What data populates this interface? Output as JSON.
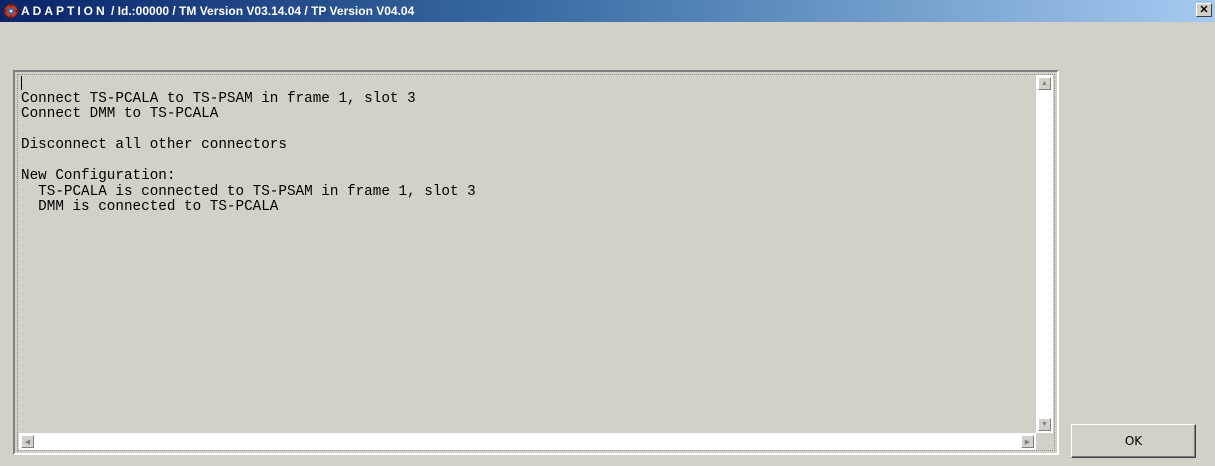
{
  "window": {
    "title_app": "ADAPTION",
    "title_rest": " / Id.:00000 / TM Version V03.14.04 / TP Version V04.04",
    "close_glyph": "✕",
    "icon": "app-gear-icon"
  },
  "content": {
    "lines": [
      "",
      "Connect TS-PCALA to TS-PSAM in frame 1, slot 3",
      "Connect DMM to TS-PCALA",
      "",
      "Disconnect all other connectors",
      "",
      "New Configuration:",
      "  TS-PCALA is connected to TS-PSAM in frame 1, slot 3",
      "  DMM is connected to TS-PCALA"
    ]
  },
  "buttons": {
    "ok_label": "OK"
  },
  "colors": {
    "titlebar_start": "#0a246a",
    "titlebar_end": "#a6caf0",
    "face": "#d4d0c8"
  }
}
